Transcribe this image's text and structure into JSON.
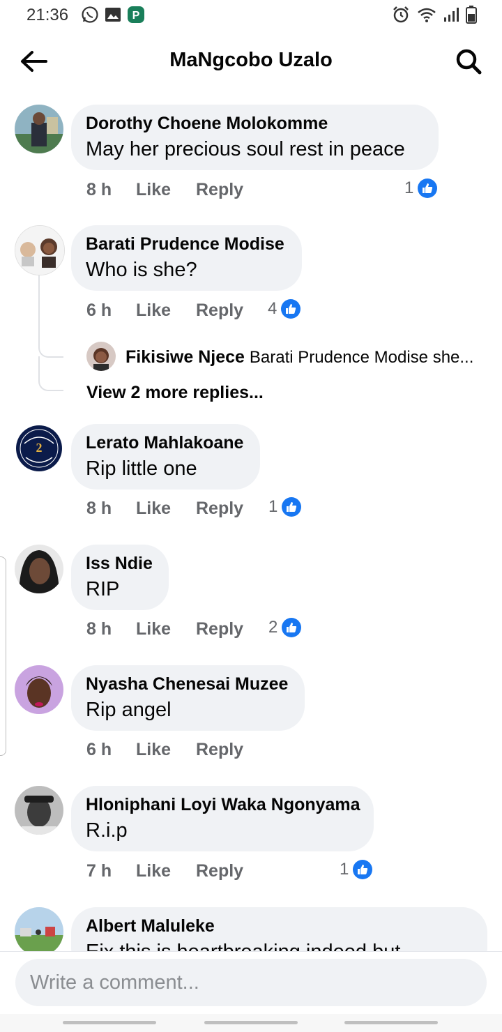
{
  "status_bar": {
    "time": "21:36"
  },
  "header": {
    "title": "MaNgcobo Uzalo",
    "back_icon": "arrow-left-icon",
    "search_icon": "search-icon"
  },
  "actions": {
    "like": "Like",
    "reply": "Reply"
  },
  "comments": [
    {
      "name": "Dorothy Choene Molokomme",
      "text": "May her precious soul rest in peace",
      "time": "8 h",
      "reactions": "1"
    },
    {
      "name": "Barati Prudence Modise",
      "text": "Who is she?",
      "time": "6 h",
      "reactions": "4",
      "reply_preview": {
        "name": "Fikisiwe Njece",
        "text": "Barati Prudence Modise she..."
      },
      "view_more": "View 2 more replies..."
    },
    {
      "name": "Lerato Mahlakoane",
      "text": "Rip little one",
      "time": "8 h",
      "reactions": "1"
    },
    {
      "name": "Iss Ndie",
      "text": "RIP",
      "time": "8 h",
      "reactions": "2"
    },
    {
      "name": "Nyasha Chenesai Muzee",
      "text": "Rip angel",
      "time": "6 h"
    },
    {
      "name": "Hloniphani Loyi Waka Ngonyama",
      "text": "R.i.p",
      "time": "7 h",
      "reactions": "1"
    },
    {
      "name": "Albert Maluleke",
      "text": "Eix this is heartbreaking indeed but"
    }
  ],
  "composer": {
    "placeholder": "Write a comment..."
  },
  "colors": {
    "accent": "#1877f2",
    "bubble": "#f0f2f5",
    "meta": "#65676b"
  }
}
